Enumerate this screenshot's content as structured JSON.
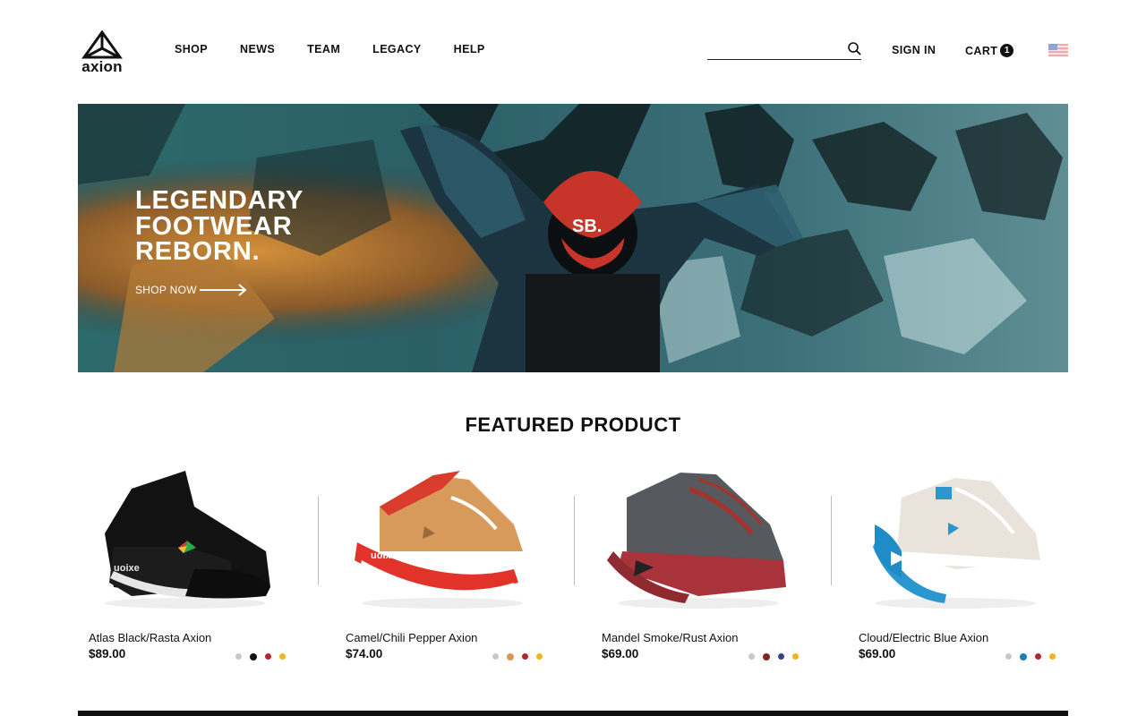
{
  "brand": {
    "name": "axion"
  },
  "nav": [
    {
      "label": "SHOP"
    },
    {
      "label": "NEWS"
    },
    {
      "label": "TEAM"
    },
    {
      "label": "LEGACY"
    },
    {
      "label": "HELP"
    }
  ],
  "search": {
    "value": "",
    "placeholder": "",
    "icon": "search-icon"
  },
  "account": {
    "sign_in_label": "SIGN IN"
  },
  "cart": {
    "label": "CART",
    "count": "1"
  },
  "locale": {
    "flag": "us-flag-icon"
  },
  "hero": {
    "title_lines": [
      "LEGENDARY",
      "FOOTWEAR",
      "REBORN."
    ],
    "cta_label": "SHOP NOW",
    "cap_text": "SB."
  },
  "featured": {
    "title": "FEATURED PRODUCT",
    "products": [
      {
        "name": "Atlas Black/Rasta Axion",
        "price": "$89.00",
        "swatches": [
          "#c8c8c8",
          "#111111",
          "#b0282b",
          "#f0b323"
        ],
        "active_swatch": 1
      },
      {
        "name": "Camel/Chili Pepper Axion",
        "price": "$74.00",
        "swatches": [
          "#c8c8c8",
          "#d49a55",
          "#b0282b",
          "#f0b323"
        ],
        "active_swatch": 1
      },
      {
        "name": "Mandel Smoke/Rust Axion",
        "price": "$69.00",
        "swatches": [
          "#c8c8c8",
          "#7d2a25",
          "#3a3f8c",
          "#f0b323"
        ],
        "active_swatch": 1
      },
      {
        "name": "Cloud/Electric Blue Axion",
        "price": "$69.00",
        "swatches": [
          "#c8c8c8",
          "#1f7db3",
          "#b0282b",
          "#f0b323"
        ],
        "active_swatch": 1
      }
    ]
  },
  "colors": {
    "text": "#111111",
    "background": "#ffffff",
    "divider": "#bdbdbd"
  }
}
